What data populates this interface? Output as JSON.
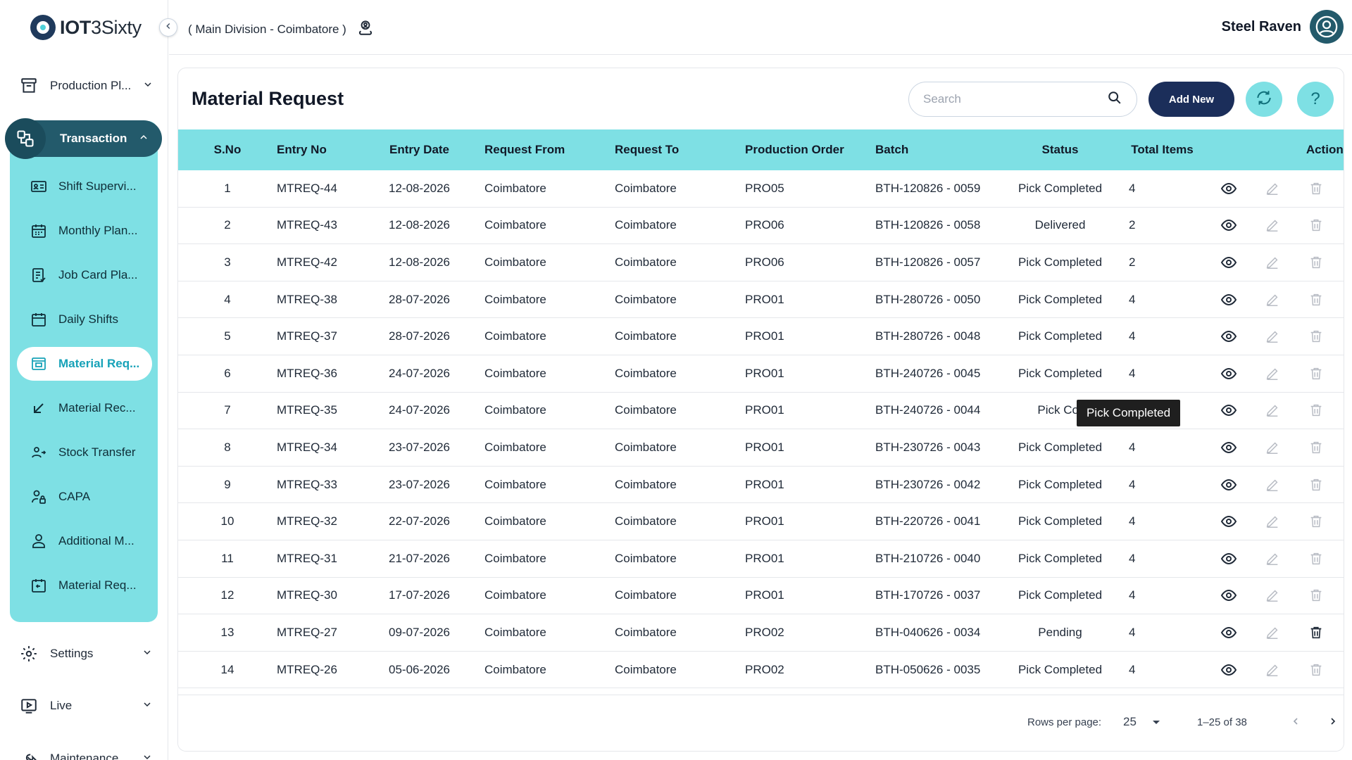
{
  "app": {
    "logo_bold": "IOT",
    "logo_rest": "3Sixty",
    "division": "( Main Division - Coimbatore )",
    "user_name": "Steel Raven"
  },
  "sidebar": {
    "production": "Production Pl...",
    "transaction": "Transaction",
    "sub_items": [
      {
        "label": "Shift Supervi...",
        "icon": "id-card-icon"
      },
      {
        "label": "Monthly Plan...",
        "icon": "calendar-grid-icon"
      },
      {
        "label": "Job Card Pla...",
        "icon": "checklist-icon"
      },
      {
        "label": "Daily Shifts",
        "icon": "calendar-icon"
      },
      {
        "label": "Material Req...",
        "icon": "window-icon"
      },
      {
        "label": "Material Rec...",
        "icon": "arrow-down-left-icon"
      },
      {
        "label": "Stock Transfer",
        "icon": "users-transfer-icon"
      },
      {
        "label": "CAPA",
        "icon": "user-lock-icon"
      },
      {
        "label": "Additional M...",
        "icon": "user-icon"
      },
      {
        "label": "Material Req...",
        "icon": "calendar-return-icon"
      }
    ],
    "settings": "Settings",
    "live": "Live",
    "maintenance": "Maintenance"
  },
  "page": {
    "title": "Material Request",
    "search_placeholder": "Search",
    "add_new": "Add New",
    "help": "?"
  },
  "table": {
    "columns": [
      "S.No",
      "Entry No",
      "Entry Date",
      "Request From",
      "Request To",
      "Production Order",
      "Batch",
      "Status",
      "Total Items",
      "Actions"
    ],
    "rows": [
      {
        "sno": "1",
        "entry": "MTREQ-44",
        "date": "12-08-2026",
        "from": "Coimbatore",
        "to": "Coimbatore",
        "po": "PRO05",
        "batch": "BTH-120826 - 0059",
        "status": "Pick Completed",
        "total": "4"
      },
      {
        "sno": "2",
        "entry": "MTREQ-43",
        "date": "12-08-2026",
        "from": "Coimbatore",
        "to": "Coimbatore",
        "po": "PRO06",
        "batch": "BTH-120826 - 0058",
        "status": "Delivered",
        "total": "2"
      },
      {
        "sno": "3",
        "entry": "MTREQ-42",
        "date": "12-08-2026",
        "from": "Coimbatore",
        "to": "Coimbatore",
        "po": "PRO06",
        "batch": "BTH-120826 - 0057",
        "status": "Pick Completed",
        "total": "2"
      },
      {
        "sno": "4",
        "entry": "MTREQ-38",
        "date": "28-07-2026",
        "from": "Coimbatore",
        "to": "Coimbatore",
        "po": "PRO01",
        "batch": "BTH-280726 - 0050",
        "status": "Pick Completed",
        "total": "4"
      },
      {
        "sno": "5",
        "entry": "MTREQ-37",
        "date": "28-07-2026",
        "from": "Coimbatore",
        "to": "Coimbatore",
        "po": "PRO01",
        "batch": "BTH-280726 - 0048",
        "status": "Pick Completed",
        "total": "4"
      },
      {
        "sno": "6",
        "entry": "MTREQ-36",
        "date": "24-07-2026",
        "from": "Coimbatore",
        "to": "Coimbatore",
        "po": "PRO01",
        "batch": "BTH-240726 - 0045",
        "status": "Pick Completed",
        "total": "4"
      },
      {
        "sno": "7",
        "entry": "MTREQ-35",
        "date": "24-07-2026",
        "from": "Coimbatore",
        "to": "Coimbatore",
        "po": "PRO01",
        "batch": "BTH-240726 - 0044",
        "status": "Pick Cor",
        "total": ""
      },
      {
        "sno": "8",
        "entry": "MTREQ-34",
        "date": "23-07-2026",
        "from": "Coimbatore",
        "to": "Coimbatore",
        "po": "PRO01",
        "batch": "BTH-230726 - 0043",
        "status": "Pick Completed",
        "total": "4"
      },
      {
        "sno": "9",
        "entry": "MTREQ-33",
        "date": "23-07-2026",
        "from": "Coimbatore",
        "to": "Coimbatore",
        "po": "PRO01",
        "batch": "BTH-230726 - 0042",
        "status": "Pick Completed",
        "total": "4"
      },
      {
        "sno": "10",
        "entry": "MTREQ-32",
        "date": "22-07-2026",
        "from": "Coimbatore",
        "to": "Coimbatore",
        "po": "PRO01",
        "batch": "BTH-220726 - 0041",
        "status": "Pick Completed",
        "total": "4"
      },
      {
        "sno": "11",
        "entry": "MTREQ-31",
        "date": "21-07-2026",
        "from": "Coimbatore",
        "to": "Coimbatore",
        "po": "PRO01",
        "batch": "BTH-210726 - 0040",
        "status": "Pick Completed",
        "total": "4"
      },
      {
        "sno": "12",
        "entry": "MTREQ-30",
        "date": "17-07-2026",
        "from": "Coimbatore",
        "to": "Coimbatore",
        "po": "PRO01",
        "batch": "BTH-170726 - 0037",
        "status": "Pick Completed",
        "total": "4"
      },
      {
        "sno": "13",
        "entry": "MTREQ-27",
        "date": "09-07-2026",
        "from": "Coimbatore",
        "to": "Coimbatore",
        "po": "PRO02",
        "batch": "BTH-040626 - 0034",
        "status": "Pending",
        "total": "4"
      },
      {
        "sno": "14",
        "entry": "MTREQ-26",
        "date": "05-06-2026",
        "from": "Coimbatore",
        "to": "Coimbatore",
        "po": "PRO02",
        "batch": "BTH-050626 - 0035",
        "status": "Pick Completed",
        "total": "4"
      }
    ],
    "tooltip": "Pick Completed"
  },
  "pagination": {
    "rows_per_page_label": "Rows per page:",
    "rows_per_page": "25",
    "range": "1–25 of 38"
  },
  "colors": {
    "accent": "#7ee0e4",
    "primary_dark": "#1b2e5a",
    "sidebar_active": "#235a6b"
  }
}
